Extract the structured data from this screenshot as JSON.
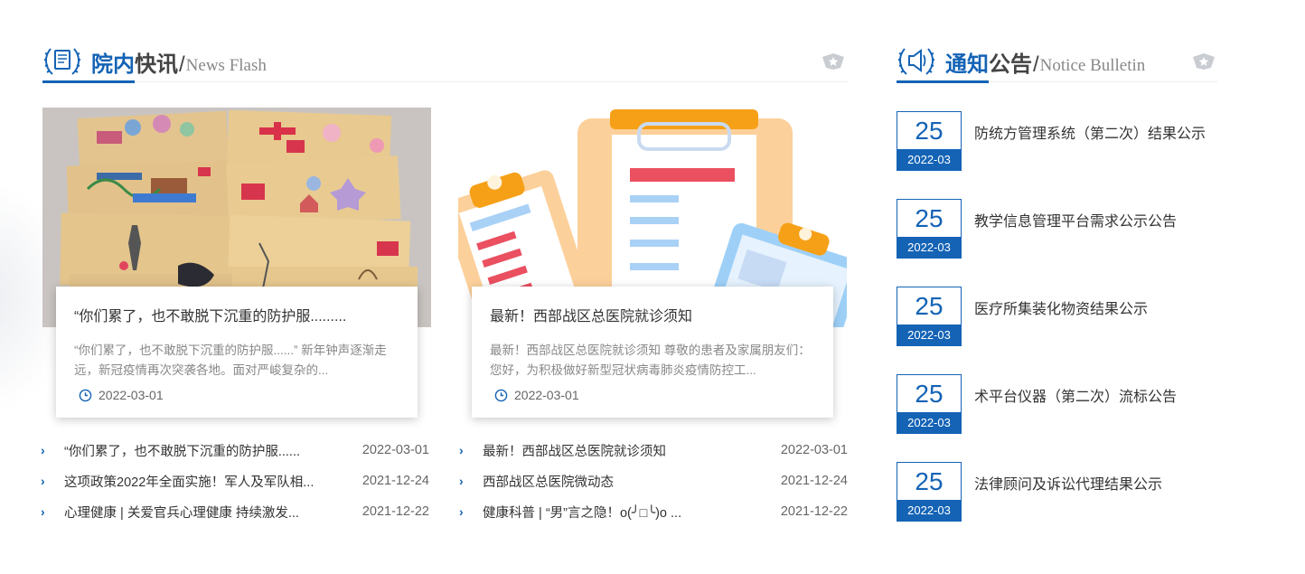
{
  "news_section": {
    "title_part1": "院内",
    "title_part2": "快讯",
    "slash": "/",
    "title_en": "News Flash",
    "more_icon": "more-badge-icon"
  },
  "notice_section": {
    "title_part1": "通知",
    "title_part2": "公告",
    "slash": "/",
    "title_en": "Notice Bulletin",
    "more_icon": "more-badge-icon"
  },
  "featured": [
    {
      "title": "“你们累了，也不敢脱下沉重的防护服.........",
      "desc": "“你们累了，也不敢脱下沉重的防护服......” 新年钟声逐渐走远，新冠疫情再次突袭各地。面对严峻复杂的...",
      "date": "2022-03-01",
      "image": "children-drawn-envelopes-photo"
    },
    {
      "title": "最新！西部战区总医院就诊须知",
      "desc": "最新！西部战区总医院就诊须知 尊敬的患者及家属朋友们：您好，为积极做好新型冠状病毒肺炎疫情防控工...",
      "date": "2022-03-01",
      "image": "clipboard-illustration"
    }
  ],
  "news_list_left": [
    {
      "title": "“你们累了，也不敢脱下沉重的防护服......",
      "date": "2022-03-01"
    },
    {
      "title": "这项政策2022年全面实施！军人及军队相...",
      "date": "2021-12-24"
    },
    {
      "title": "心理健康 | 关爱官兵心理健康 持续激发...",
      "date": "2021-12-22"
    }
  ],
  "news_list_right": [
    {
      "title": "最新！西部战区总医院就诊须知",
      "date": "2022-03-01"
    },
    {
      "title": "西部战区总医院微动态",
      "date": "2021-12-24"
    },
    {
      "title": "健康科普 | “男”言之隐！o(╯□╰)o ...",
      "date": "2021-12-22"
    }
  ],
  "notices": [
    {
      "day": "25",
      "ym": "2022-03",
      "title": "防统方管理系统（第二次）结果公示"
    },
    {
      "day": "25",
      "ym": "2022-03",
      "title": "教学信息管理平台需求公示公告"
    },
    {
      "day": "25",
      "ym": "2022-03",
      "title": "医疗所集装化物资结果公示"
    },
    {
      "day": "25",
      "ym": "2022-03",
      "title": "术平台仪器（第二次）流标公告"
    },
    {
      "day": "25",
      "ym": "2022-03",
      "title": "法律顾问及诉讼代理结果公示"
    }
  ],
  "colors": {
    "brand": "#1463b5",
    "accent_orange": "#f7a21b",
    "accent_red": "#e8505b"
  }
}
